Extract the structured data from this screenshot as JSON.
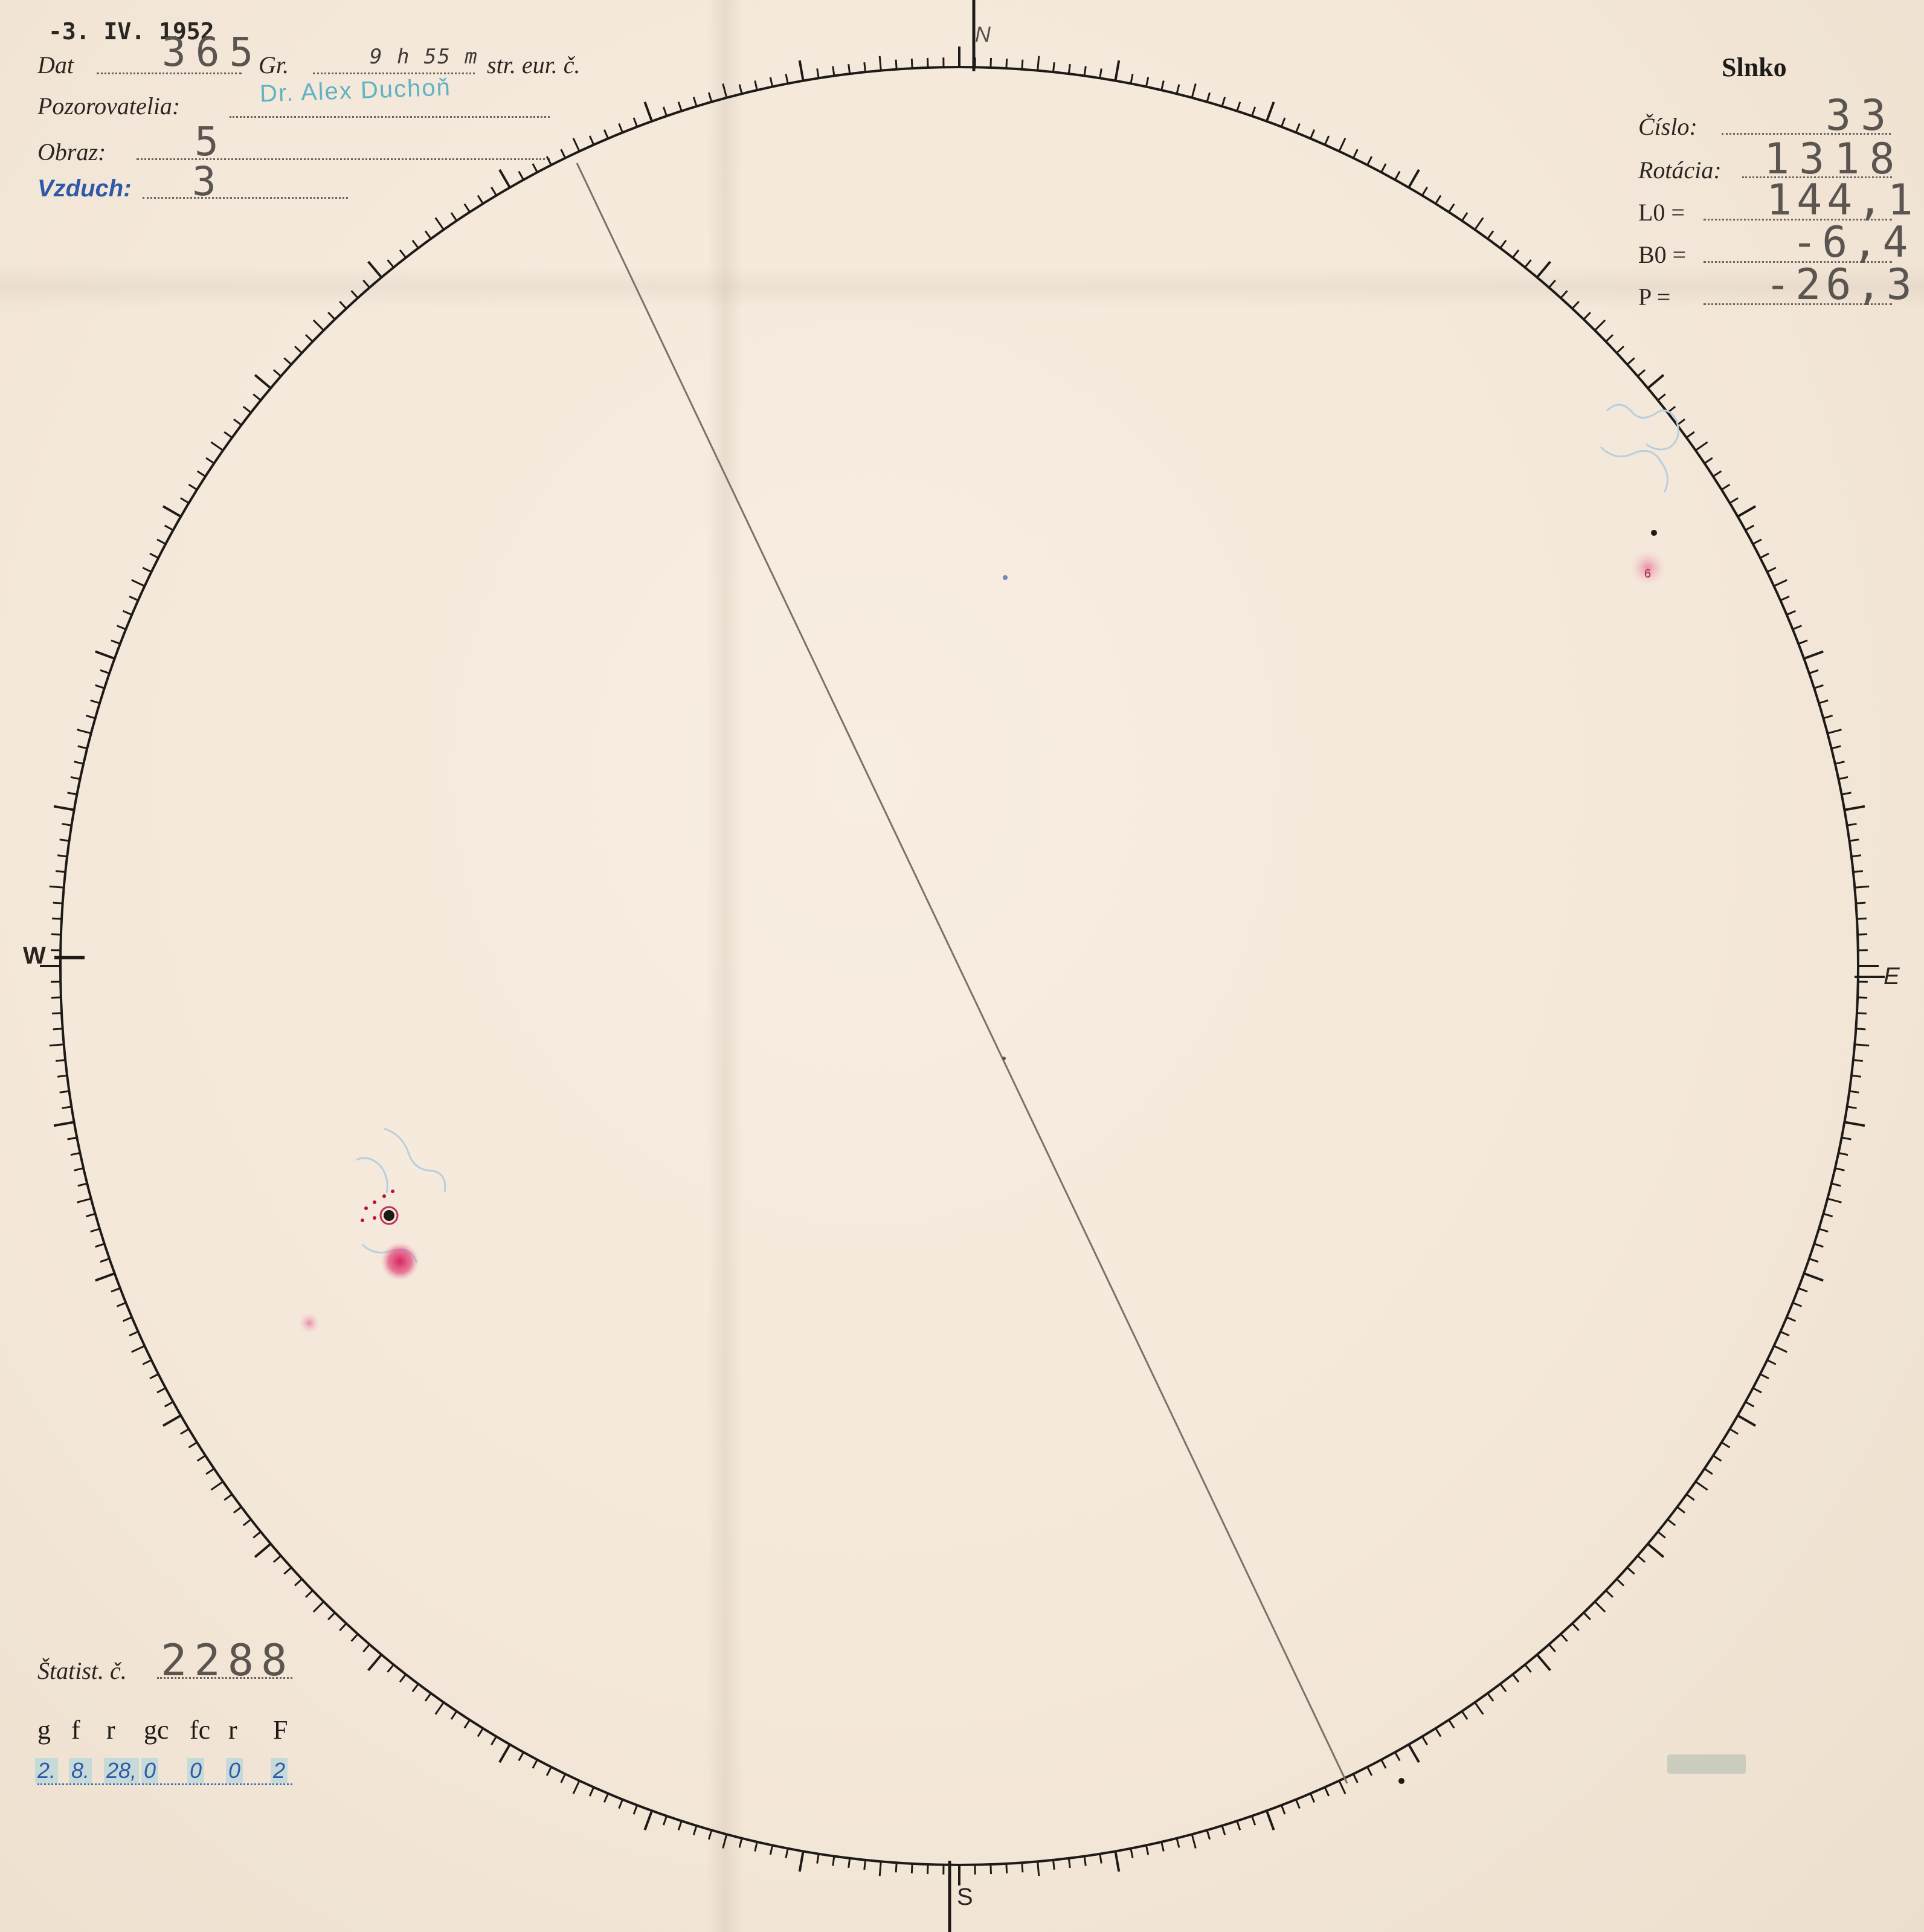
{
  "sheet": {
    "stamp_date": "-3. IV. 1952",
    "title": "Slnko",
    "labels": {
      "dat": "Dat",
      "gr": "Gr.",
      "time_suffix": "str. eur. č.",
      "pozorovatelia": "Pozorovatelia:",
      "obraz": "Obraz:",
      "vzduch": "Vzduch:",
      "cislo": "Číslo:",
      "rotacia": "Rotácia:",
      "l0": "L0 =",
      "b0": "B0 =",
      "p": "P =",
      "statist": "Štatist. č."
    },
    "values": {
      "dat": "365",
      "time": "9 h 55 m",
      "observer": "Dr. Alex Duchoň",
      "obraz": "5",
      "vzduch": "3",
      "cislo": "33",
      "rotacia": "1318",
      "l0": "144,1",
      "b0": "-6,4",
      "p": "-26,3",
      "statist": "2288"
    },
    "counts_table": {
      "headers": [
        "g",
        "f",
        "r",
        "gc",
        "fc",
        "r",
        "F"
      ],
      "values": [
        "2.",
        "8.",
        "28,",
        "0",
        "0",
        "0",
        "2"
      ]
    }
  },
  "disk": {
    "cardinals": {
      "north": "N",
      "south": "S",
      "west": "W",
      "east": "E"
    },
    "spot_groups": [
      {
        "label": "6"
      }
    ]
  },
  "colors": {
    "paper": "#f4e8da",
    "ink": "#2a2420",
    "spot_red": "#d8185a",
    "stamp_cyan": "#5fb3c4",
    "pen_blue": "#2d5aa8"
  }
}
